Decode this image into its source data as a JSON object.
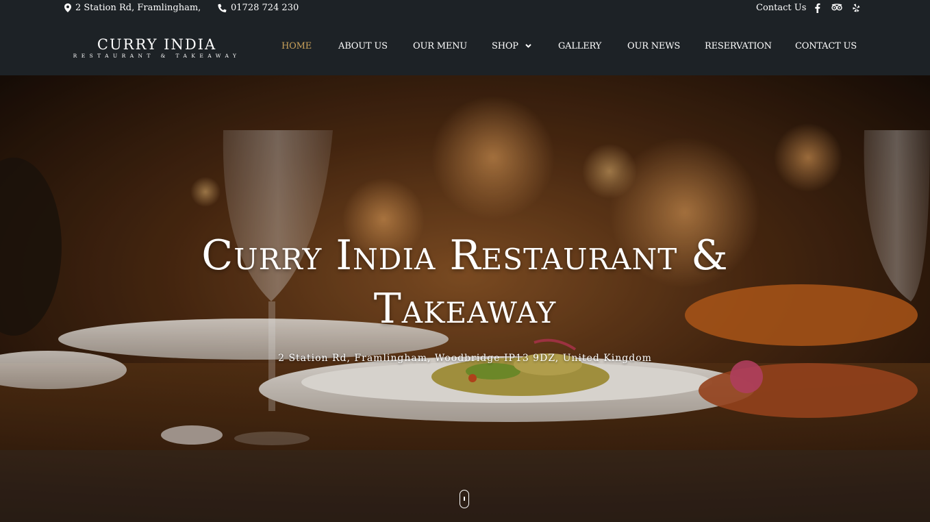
{
  "topbar": {
    "address": "2 Station Rd, Framlingham,",
    "phone": "01728 724 230",
    "contact_link": "Contact Us",
    "address_icon": "map-marker-icon",
    "phone_icon": "phone-icon",
    "social": [
      "facebook-icon",
      "tripadvisor-icon",
      "yelp-icon"
    ]
  },
  "logo": {
    "main": "CURRY INDIA",
    "sub": "RESTAURANT & TAKEAWAY"
  },
  "nav": {
    "items": [
      {
        "label": "HOME",
        "active": true
      },
      {
        "label": "ABOUT US"
      },
      {
        "label": "OUR MENU"
      },
      {
        "label": "SHOP",
        "dropdown": true
      },
      {
        "label": "GALLERY"
      },
      {
        "label": "OUR NEWS"
      },
      {
        "label": "RESERVATION"
      },
      {
        "label": "CONTACT US"
      }
    ]
  },
  "hero": {
    "title_line1": "Curry India Restaurant &",
    "title_line2": "Takeaway",
    "subtitle": "2 Station Rd, Framlingham, Woodbridge IP13 9DZ, United Kingdom"
  },
  "colors": {
    "header_bg": "#1d2226",
    "active_nav": "#c9a15a",
    "text": "#ffffff"
  }
}
